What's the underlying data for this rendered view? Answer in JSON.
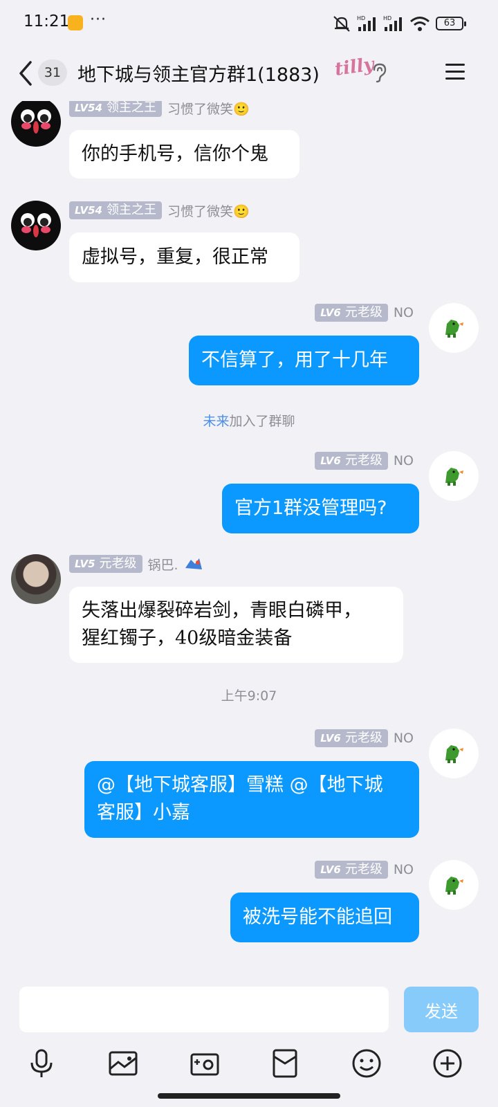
{
  "status_bar": {
    "time": "11:21",
    "more": "···",
    "network_labels": [
      "HD",
      "HD"
    ],
    "battery": "63"
  },
  "header": {
    "unread_count": "31",
    "title": "地下城与领主官方群1(1883)",
    "title_logo": "tilly"
  },
  "messages": [
    {
      "type": "incoming",
      "level": "LV54",
      "title": "领主之王",
      "nickname": "习惯了微笑🙂",
      "avatar": "black-face",
      "text": "你的手机号，信你个鬼"
    },
    {
      "type": "incoming",
      "level": "LV54",
      "title": "领主之王",
      "nickname": "习惯了微笑🙂",
      "avatar": "black-face",
      "text": "虚拟号，重复，很正常"
    },
    {
      "type": "outgoing",
      "level": "LV6",
      "title": "元老级",
      "nickname": "NO",
      "avatar": "dino",
      "text": "不信算了，用了十几年"
    },
    {
      "type": "system",
      "name": "未来",
      "text": "加入了群聊"
    },
    {
      "type": "outgoing",
      "level": "LV6",
      "title": "元老级",
      "nickname": "NO",
      "avatar": "dino",
      "text": "官方1群没管理吗?"
    },
    {
      "type": "incoming",
      "level": "LV5",
      "title": "元老级",
      "nickname": "锅巴.",
      "avatar": "photo",
      "lines": [
        "失落出爆裂碎岩剑，青眼白磷甲，",
        "猩红镯子，40级暗金装备"
      ]
    },
    {
      "type": "time",
      "text": "上午9:07"
    },
    {
      "type": "outgoing",
      "level": "LV6",
      "title": "元老级",
      "nickname": "NO",
      "avatar": "dino",
      "lines": [
        "@【地下城客服】雪糕 @【地下城",
        "客服】小嘉"
      ]
    },
    {
      "type": "outgoing",
      "level": "LV6",
      "title": "元老级",
      "nickname": "NO",
      "avatar": "dino",
      "text": "被洗号能不能追回"
    }
  ],
  "input": {
    "value": "",
    "send_label": "发送"
  },
  "toolbar": {
    "icons": [
      "microphone-icon",
      "image-icon",
      "camera-icon",
      "red-packet-icon",
      "emoji-icon",
      "plus-icon"
    ]
  },
  "colors": {
    "outgoing_bubble": "#0b99ff",
    "incoming_bubble": "#ffffff",
    "background": "#f1f1f6",
    "level_tag": "#b5b9cb",
    "system_name": "#4d8fe8",
    "send_disabled": "#87cbfb"
  }
}
